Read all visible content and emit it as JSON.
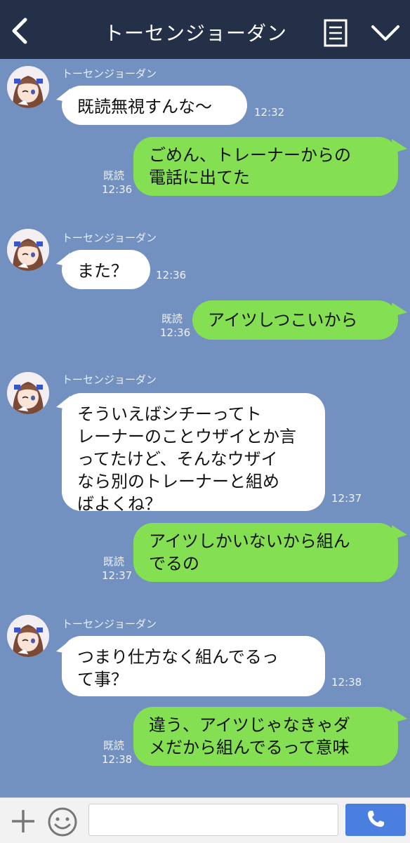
{
  "header": {
    "title": "トーセンジョーダン",
    "back_icon": "chevron-left-icon",
    "menu_icon": "notes-icon",
    "expand_icon": "chevron-down-icon"
  },
  "colors": {
    "header_bg": "#243048",
    "chat_bg": "#7291c0",
    "incoming_bubble": "#ffffff",
    "outgoing_bubble": "#84e052",
    "call_button": "#4a7fe0"
  },
  "messages": [
    {
      "direction": "in",
      "sender": "トーセンジョーダン",
      "text": "既読無視すんな〜",
      "time": "12:32"
    },
    {
      "direction": "out",
      "text": "ごめん、トレーナーからの\n電話に出てた",
      "read": "既読",
      "time": "12:36"
    },
    {
      "direction": "in",
      "sender": "トーセンジョーダン",
      "text": "また？",
      "time": "12:36"
    },
    {
      "direction": "out",
      "text": "アイツしつこいから",
      "read": "既読",
      "time": "12:36"
    },
    {
      "direction": "in",
      "sender": "トーセンジョーダン",
      "text": "そういえばシチーってト\nレーナーのことウザイとか言\nってたけど、そんなウザイ\nなら別のトレーナーと組め\nばよくね？",
      "time": "12:37"
    },
    {
      "direction": "out",
      "text": "アイツしかいないから組ん\nでるの",
      "read": "既読",
      "time": "12:37"
    },
    {
      "direction": "in",
      "sender": "トーセンジョーダン",
      "text": "つまり仕方なく組んでるっ\nて事？",
      "time": "12:38"
    },
    {
      "direction": "out",
      "text": "違う、アイツじゃなきゃダ\nメだから組んでるって意味",
      "read": "既読",
      "time": "12:38"
    }
  ],
  "footer": {
    "input_value": "",
    "plus_icon": "plus-icon",
    "emoji_icon": "smiley-icon",
    "call_icon": "phone-icon"
  }
}
